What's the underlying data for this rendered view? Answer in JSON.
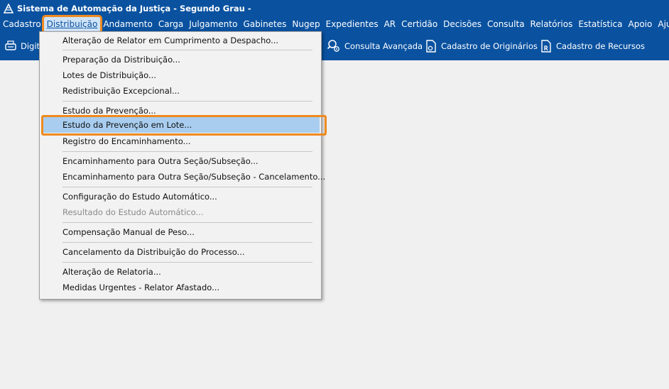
{
  "window": {
    "title": "Sistema de Automação da Justiça - Segundo Grau -"
  },
  "menubar": {
    "items": [
      "Cadastro",
      "Distribuição",
      "Andamento",
      "Carga",
      "Julgamento",
      "Gabinetes",
      "Nugep",
      "Expedientes",
      "AR",
      "Certidão",
      "Decisões",
      "Consulta",
      "Relatórios",
      "Estatística",
      "Apoio",
      "Ajuda"
    ],
    "active": "Distribuição"
  },
  "toolbar": {
    "items": [
      {
        "label": "Digit",
        "icon": "scanner-icon"
      },
      {
        "label": "Consulta Avançada",
        "icon": "gear-search-icon"
      },
      {
        "label": "Cadastro de Originários",
        "icon": "document-o-icon"
      },
      {
        "label": "Cadastro de Recursos",
        "icon": "document-r-icon"
      }
    ]
  },
  "dropdown": {
    "items": [
      {
        "label": "Alteração de Relator em Cumprimento a Despacho...",
        "enabled": true
      },
      {
        "label": "Preparação da Distribuição...",
        "enabled": true
      },
      {
        "label": "Lotes de Distribuição...",
        "enabled": true
      },
      {
        "label": "Redistribuição Excepcional...",
        "enabled": true
      },
      {
        "label": "Estudo da Prevenção...",
        "enabled": true
      },
      {
        "label": "Estudo da Prevenção em Lote...",
        "enabled": true,
        "selected": true
      },
      {
        "label": "Registro do Encaminhamento...",
        "enabled": true
      },
      {
        "label": "Encaminhamento para Outra Seção/Subseção...",
        "enabled": true
      },
      {
        "label": "Encaminhamento para Outra Seção/Subseção - Cancelamento...",
        "enabled": true
      },
      {
        "label": "Configuração do Estudo Automático...",
        "enabled": true
      },
      {
        "label": "Resultado do Estudo Automático...",
        "enabled": false
      },
      {
        "label": "Compensação Manual de Peso...",
        "enabled": true
      },
      {
        "label": "Cancelamento da Distribuição do Processo...",
        "enabled": true
      },
      {
        "label": "Alteração de Relatoria...",
        "enabled": true
      },
      {
        "label": "Medidas Urgentes - Relator Afastado...",
        "enabled": true
      }
    ]
  },
  "colors": {
    "brand": "#0a52a0",
    "highlight": "#ef8a1f",
    "selection": "#a8cdef"
  }
}
